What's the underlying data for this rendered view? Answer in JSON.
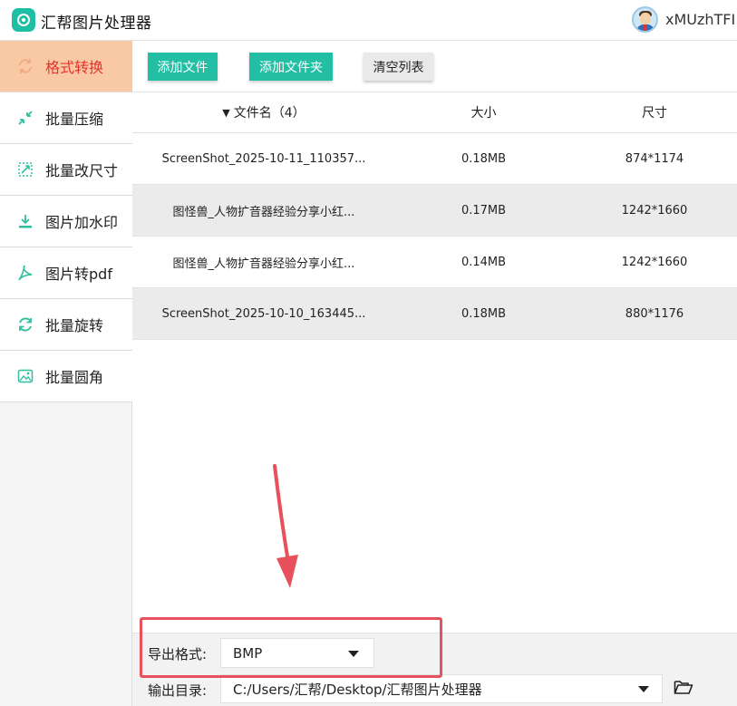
{
  "app": {
    "title": "汇帮图片处理器",
    "username": "xMUzhTFI",
    "logo_icon": "app-logo-icon",
    "accent_color": "#22bfa5"
  },
  "sidebar": {
    "items": [
      {
        "label": "格式转换",
        "icon": "format-convert-icon",
        "active": true
      },
      {
        "label": "批量压缩",
        "icon": "compress-icon",
        "active": false
      },
      {
        "label": "批量改尺寸",
        "icon": "resize-icon",
        "active": false
      },
      {
        "label": "图片加水印",
        "icon": "watermark-icon",
        "active": false
      },
      {
        "label": "图片转pdf",
        "icon": "pdf-icon",
        "active": false
      },
      {
        "label": "批量旋转",
        "icon": "rotate-icon",
        "active": false
      },
      {
        "label": "批量圆角",
        "icon": "rounded-corner-icon",
        "active": false
      }
    ]
  },
  "toolbar": {
    "add_file": "添加文件",
    "add_folder": "添加文件夹",
    "clear_list": "清空列表"
  },
  "table": {
    "headers": {
      "name": "文件名（4）",
      "size": "大小",
      "dimensions": "尺寸"
    },
    "rows": [
      {
        "name": "ScreenShot_2025-10-11_110357...",
        "size": "0.18MB",
        "dimensions": "874*1174"
      },
      {
        "name": "图怪兽_人物扩音器经验分享小红...",
        "size": "0.17MB",
        "dimensions": "1242*1660"
      },
      {
        "name": "图怪兽_人物扩音器经验分享小红...",
        "size": "0.14MB",
        "dimensions": "1242*1660"
      },
      {
        "name": "ScreenShot_2025-10-10_163445...",
        "size": "0.18MB",
        "dimensions": "880*1176"
      }
    ]
  },
  "export": {
    "format_label": "导出格式:",
    "format_value": "BMP",
    "output_label": "输出目录:",
    "output_value": "C:/Users/汇帮/Desktop/汇帮图片处理器"
  }
}
